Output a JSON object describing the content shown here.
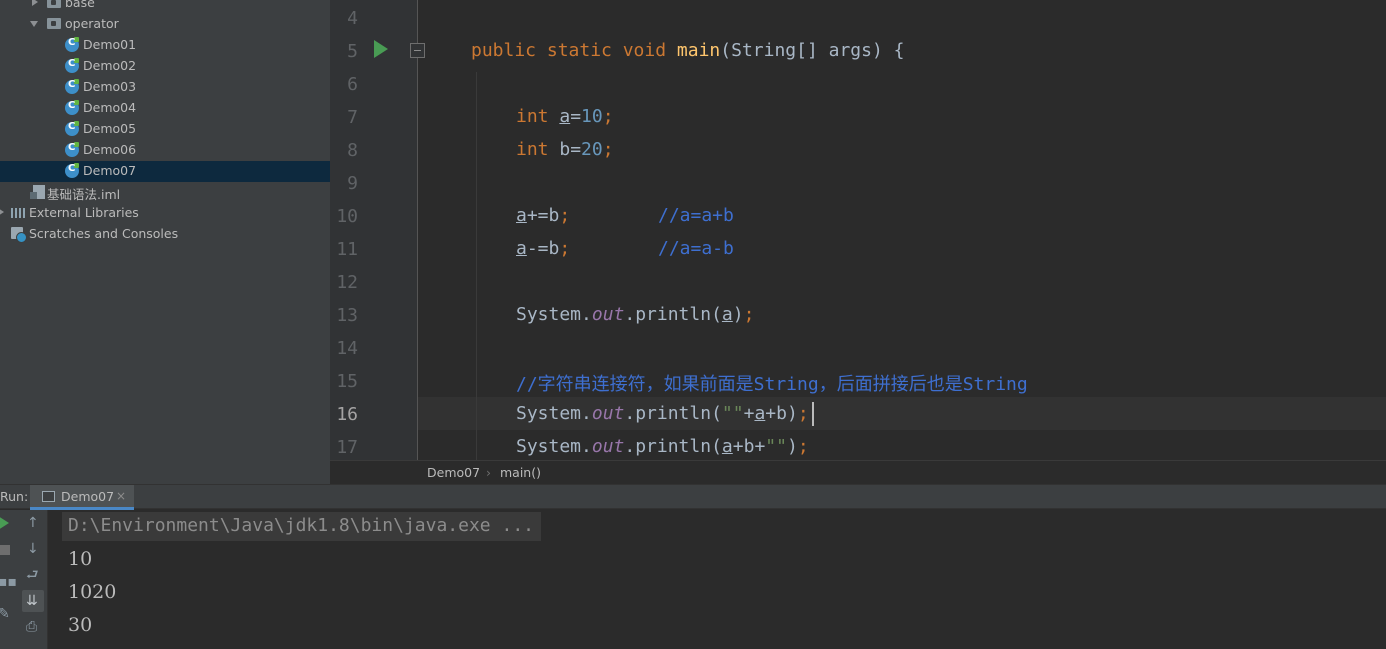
{
  "project_tree": {
    "items": [
      {
        "label": "base",
        "kind": "folder",
        "expanded": false
      },
      {
        "label": "operator",
        "kind": "folder",
        "expanded": true
      },
      {
        "label": "Demo01",
        "kind": "class"
      },
      {
        "label": "Demo02",
        "kind": "class"
      },
      {
        "label": "Demo03",
        "kind": "class"
      },
      {
        "label": "Demo04",
        "kind": "class"
      },
      {
        "label": "Demo05",
        "kind": "class"
      },
      {
        "label": "Demo06",
        "kind": "class"
      },
      {
        "label": "Demo07",
        "kind": "class",
        "selected": true
      },
      {
        "label": "基础语法.iml",
        "kind": "iml"
      },
      {
        "label": "External Libraries",
        "kind": "library",
        "expanded": false
      },
      {
        "label": "Scratches and Consoles",
        "kind": "scratch"
      }
    ]
  },
  "editor": {
    "line_numbers": [
      "4",
      "5",
      "6",
      "7",
      "8",
      "9",
      "10",
      "11",
      "12",
      "13",
      "14",
      "15",
      "16",
      "17"
    ],
    "current_line": "16",
    "code": {
      "l5": {
        "kw1": "public static void ",
        "fn": "main",
        "rest": "(String[] args) {"
      },
      "l7": {
        "kw": "int ",
        "var": "a",
        "op": "=",
        "num": "10",
        "semi": ";"
      },
      "l8": {
        "kw": "int ",
        "rest": "b=",
        "num": "20",
        "semi": ";"
      },
      "l10": {
        "var": "a",
        "rest": "+=b",
        "semi": ";",
        "comment": "//a=a+b"
      },
      "l11": {
        "var": "a",
        "rest": "-=b",
        "semi": ";",
        "comment": "//a=a-b"
      },
      "l13": {
        "cls": "System.",
        "fld": "out",
        "call": ".println(",
        "var": "a",
        "close": ")",
        "semi": ";"
      },
      "l15": {
        "comment": "//字符串连接符，如果前面是String，后面拼接后也是String"
      },
      "l16": {
        "cls": "System.",
        "fld": "out",
        "call": ".println(",
        "str": "\"\"",
        "plus": "+",
        "var": "a",
        "rest": "+b)",
        "semi": ";"
      },
      "l17": {
        "cls": "System.",
        "fld": "out",
        "call": ".println(",
        "var": "a",
        "rest": "+b+",
        "str": "\"\"",
        "close": ")",
        "semi": ";"
      }
    }
  },
  "breadcrumb": {
    "file": "Demo07",
    "sep": "›",
    "method": "main()"
  },
  "run_window": {
    "label": "Run:",
    "tab_label": "Demo07",
    "tab_close": "×",
    "command": "D:\\Environment\\Java\\jdk1.8\\bin\\java.exe ...",
    "output": [
      "10",
      "1020",
      "30"
    ]
  },
  "colors": {
    "keyword": "#cc7832",
    "method": "#ffc66d",
    "number": "#6897bb",
    "comment": "#3e6fd0",
    "field": "#9876aa",
    "selection": "#0d293e"
  }
}
